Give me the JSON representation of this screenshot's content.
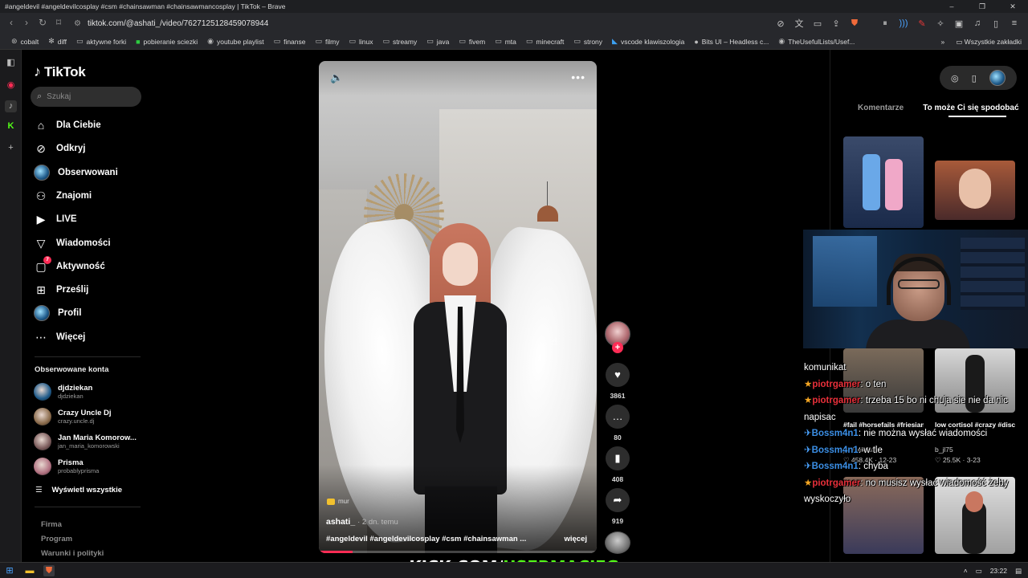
{
  "window": {
    "title": "#angeldevil #angeldevilcosplay #csm #chainsawman #chainsawmancosplay | TikTok – Brave",
    "controls": [
      "–",
      "❐",
      "✕"
    ]
  },
  "navbar": {
    "url": "tiktok.com/@ashati_/video/7627125128459078944"
  },
  "bookmarks": {
    "items": [
      {
        "label": "cobalt",
        "icon": "cobalt-icon"
      },
      {
        "label": "diff",
        "icon": "diff-icon"
      },
      {
        "label": "aktywne forki",
        "icon": "folder-icon"
      },
      {
        "label": "pobieranie sciezki",
        "icon": "green-square-icon"
      },
      {
        "label": "youtube playlist",
        "icon": "globe-icon"
      },
      {
        "label": "finanse",
        "icon": "folder-icon"
      },
      {
        "label": "filmy",
        "icon": "folder-icon"
      },
      {
        "label": "linux",
        "icon": "folder-icon"
      },
      {
        "label": "streamy",
        "icon": "folder-icon"
      },
      {
        "label": "java",
        "icon": "folder-icon"
      },
      {
        "label": "fivem",
        "icon": "folder-icon"
      },
      {
        "label": "mta",
        "icon": "folder-icon"
      },
      {
        "label": "minecraft",
        "icon": "folder-icon"
      },
      {
        "label": "strony",
        "icon": "folder-icon"
      },
      {
        "label": "vscode klawiszologia",
        "icon": "vscode-icon"
      },
      {
        "label": "Bits UI – Headless c...",
        "icon": "circle-icon"
      },
      {
        "label": "TheUsefulLists/Usef...",
        "icon": "github-icon"
      }
    ],
    "overflow": "»",
    "all_bookmarks": "Wszystkie zakładki"
  },
  "tiktok": {
    "logo": "TikTok",
    "search_placeholder": "Szukaj",
    "menu": [
      {
        "label": "Dla Ciebie",
        "icon": "home-icon"
      },
      {
        "label": "Odkryj",
        "icon": "compass-icon"
      },
      {
        "label": "Obserwowani",
        "icon": "following-avatar-icon"
      },
      {
        "label": "Znajomi",
        "icon": "friends-icon"
      },
      {
        "label": "LIVE",
        "icon": "live-icon"
      },
      {
        "label": "Wiadomości",
        "icon": "send-icon"
      },
      {
        "label": "Aktywność",
        "icon": "activity-icon",
        "badge": "7"
      },
      {
        "label": "Prześlij",
        "icon": "upload-icon"
      },
      {
        "label": "Profil",
        "icon": "profile-avatar-icon"
      },
      {
        "label": "Więcej",
        "icon": "more-dots-icon"
      }
    ],
    "followed_title": "Obserwowane konta",
    "followed": [
      {
        "name": "djdziekan",
        "handle": "djdziekan",
        "color": "#1e5a8a"
      },
      {
        "name": "Crazy Uncle Dj",
        "handle": "crazy.uncle.dj",
        "color": "#8a6a4a"
      },
      {
        "name": "Jan Maria Komorow...",
        "handle": "jan_maria_komorowski",
        "color": "#7a5a5a"
      },
      {
        "name": "Prisma",
        "handle": "probablyprisma",
        "color": "#b07080"
      }
    ],
    "see_all": "Wyświetl wszystkie",
    "footer": [
      "Firma",
      "Program",
      "Warunki i polityki"
    ]
  },
  "video": {
    "music_tag": "mur",
    "author": "ashati_",
    "time_ago": "· 2 dn. temu",
    "caption": "#angeldevil #angeldevilcosplay #csm #chainsawman ...",
    "more": "więcej",
    "progress": 0.12
  },
  "actions": {
    "likes": "3861",
    "comments": "80",
    "saves": "408",
    "shares": "919"
  },
  "right_panel": {
    "tabs": [
      "Komentarze",
      "To może Ci się spodobać"
    ],
    "active_tab": 1,
    "thumbs": [
      {
        "caption": "#fail #horsefails #friesian...",
        "author": "janinekrist",
        "stats": "♡ 458.4K · 12-23"
      },
      {
        "caption": "low cortisol #crazy #disco #cortisol...",
        "author": "b_jl75",
        "stats": "♡ 25.5K · 3-23"
      }
    ]
  },
  "chat": {
    "lines": [
      {
        "kind": "plain",
        "text": "komunikat"
      },
      {
        "kind": "star",
        "user": "piotrgamer",
        "ucolor": "red",
        "text": ": o ten"
      },
      {
        "kind": "star",
        "user": "piotrgamer",
        "ucolor": "red",
        "text": ": trzeba 15 bo ni chuja sie nie da nic napisac"
      },
      {
        "kind": "pin",
        "user": "Bossm4n1",
        "ucolor": "blue",
        "text": ": nie można wysłać wiadomości"
      },
      {
        "kind": "pin",
        "user": "Bossm4n1",
        "ucolor": "blue",
        "text": ": w tle"
      },
      {
        "kind": "pin",
        "user": "Bossm4n1",
        "ucolor": "blue",
        "text": ": chyba"
      },
      {
        "kind": "star",
        "user": "piotrgamer",
        "ucolor": "red",
        "text": ": no musisz wysłać wiadomość żeby wyskoczyło"
      }
    ]
  },
  "overlay": {
    "kick_prefix": "KICK.COM/",
    "kick_user": "USERMACIEG",
    "kick_color": "#53fc18"
  },
  "taskbar": {
    "time": "23:22"
  }
}
